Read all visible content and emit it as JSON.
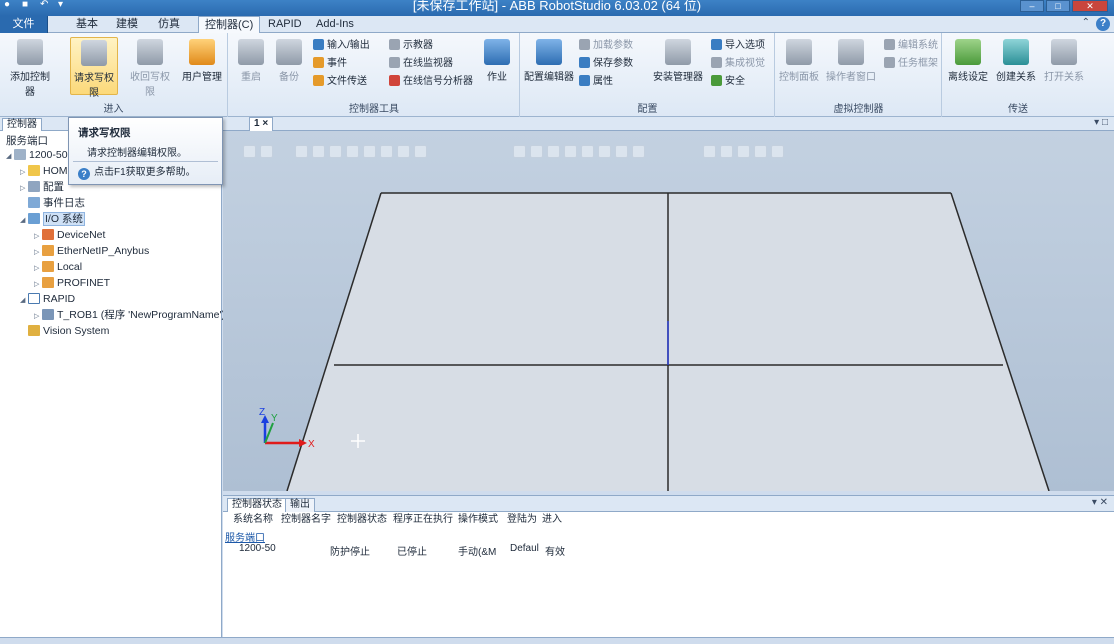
{
  "window": {
    "title": "[未保存工作站] - ABB RobotStudio 6.03.02 (64 位)"
  },
  "ribbon_tabs": [
    {
      "label": "文件 (F)"
    },
    {
      "label": "基本"
    },
    {
      "label": "建模"
    },
    {
      "label": "仿真"
    },
    {
      "label": "控制器(C)"
    },
    {
      "label": "RAPID"
    },
    {
      "label": "Add-Ins"
    }
  ],
  "ribbon": {
    "groups": [
      {
        "label": "进入"
      },
      {
        "label": "控制器工具"
      },
      {
        "label": "配置"
      },
      {
        "label": "虚拟控制器"
      },
      {
        "label": "传送"
      }
    ],
    "buttons": {
      "add_controller": "添加控制器",
      "request_write": "请求写权限",
      "release_write": "收回写权限",
      "user_mgmt": "用户管理",
      "restart": "重启",
      "backup": "备份",
      "io": "输入/输出",
      "events": "事件",
      "file_transfer": "文件传送",
      "fpu": "示教器",
      "online_monitor": "在线监视器",
      "signal_analyzer": "在线信号分析器",
      "task": "作业",
      "config_editor": "配置编辑器",
      "load_params": "加载参数",
      "save_params": "保存参数",
      "properties": "属性",
      "install_mgr": "安装管理器",
      "import_options": "导入选项",
      "integrated_vision": "集成视觉",
      "safety": "安全",
      "control_panel": "控制面板",
      "operator_window": "操作者窗口",
      "edit_system": "编辑系统",
      "task_frame": "任务框架",
      "offline_setting": "离线设定",
      "create_relation": "创建关系",
      "open_relation": "打开关系"
    }
  },
  "left_panel": {
    "tab": "控制器",
    "tree": [
      {
        "label": "服务端口",
        "level": 0
      },
      {
        "label": "1200-50",
        "level": 0
      },
      {
        "label": "HOM",
        "level": 1
      },
      {
        "label": "配置",
        "level": 1
      },
      {
        "label": "事件日志",
        "level": 1
      },
      {
        "label": "I/O 系统",
        "level": 1
      },
      {
        "label": "DeviceNet",
        "level": 2
      },
      {
        "label": "EtherNetIP_Anybus",
        "level": 2
      },
      {
        "label": "Local",
        "level": 2
      },
      {
        "label": "PROFINET",
        "level": 2
      },
      {
        "label": "RAPID",
        "level": 1
      },
      {
        "label": "T_ROB1 (程序 'NewProgramName')",
        "level": 2
      },
      {
        "label": "Vision System",
        "level": 1
      }
    ]
  },
  "tooltip": {
    "title": "请求写权限",
    "description": "请求控制器编辑权限。",
    "help": "点击F1获取更多帮助。"
  },
  "document": {
    "tab_label": "1 ×"
  },
  "viewport": {
    "axis_x": "X",
    "axis_y": "Y",
    "axis_z": "Z",
    "floor_color": "#d7dde5",
    "grid_color": "#2b2b2b"
  },
  "bottom_panel": {
    "tabs": [
      {
        "label": "控制器状态"
      },
      {
        "label": "输出"
      }
    ],
    "columns": [
      "系统名称",
      "控制器名字",
      "控制器状态",
      "程序正在执行",
      "操作模式",
      "登陆为",
      "进入"
    ],
    "group": "服务端口",
    "row": [
      "1200-50",
      "防护停止",
      "已停止",
      "手动(&M",
      "Defaul",
      "有效"
    ]
  }
}
